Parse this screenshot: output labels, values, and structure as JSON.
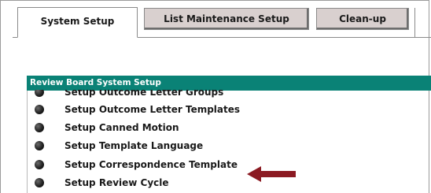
{
  "tabs": [
    {
      "label": "System Setup",
      "active": true
    },
    {
      "label": "List Maintenance Setup",
      "active": false
    },
    {
      "label": "Clean-up",
      "active": false
    }
  ],
  "panel": {
    "title": "Review Board System Setup"
  },
  "menu_items": [
    {
      "label": "Setup Outcome Letter Groups"
    },
    {
      "label": "Setup Outcome Letter Templates"
    },
    {
      "label": "Setup Canned Motion"
    },
    {
      "label": "Setup Template Language"
    },
    {
      "label": "Setup Correspondence Template"
    },
    {
      "label": "Setup Review Cycle"
    }
  ],
  "colors": {
    "panel_header": "#0a8276",
    "arrow": "#8b1a22",
    "tab_inactive": "#d9d0cf"
  },
  "annotation": {
    "arrow_target": "Setup Correspondence Template"
  }
}
